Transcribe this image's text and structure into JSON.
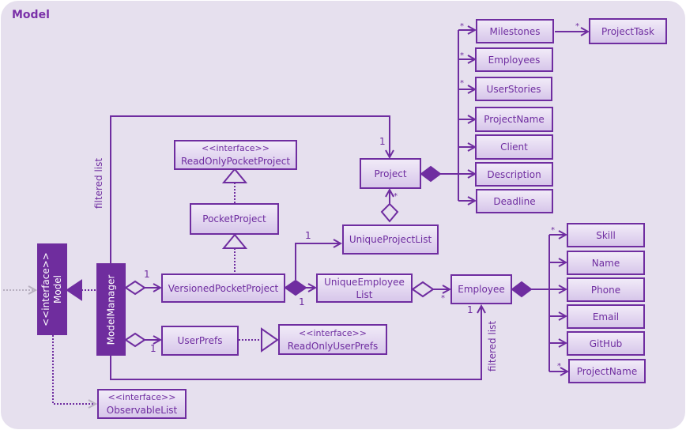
{
  "diagram": {
    "title": "Model",
    "colors": {
      "primary": "#6f2da0",
      "background": "#e6e0ee",
      "box_fill_top": "#f1ebf8",
      "box_fill_bottom": "#d7c6ea"
    },
    "interface_model": {
      "stereotype": "<<interface>>",
      "name": "Model"
    },
    "model_manager": {
      "name": "ModelManager"
    },
    "read_only_pocket_project": {
      "stereotype": "<<interface>>",
      "name": "ReadOnlyPocketProject"
    },
    "pocket_project": {
      "name": "PocketProject"
    },
    "versioned_pocket_project": {
      "name": "VersionedPocketProject"
    },
    "unique_project_list": {
      "name": "UniqueProjectList"
    },
    "unique_employee_list": {
      "name_line1": "UniqueEmployee",
      "name_line2": "List"
    },
    "project": {
      "name": "Project"
    },
    "employee": {
      "name": "Employee"
    },
    "user_prefs": {
      "name": "UserPrefs"
    },
    "read_only_user_prefs": {
      "stereotype": "<<interface>>",
      "name": "ReadOnlyUserPrefs"
    },
    "observable_list": {
      "stereotype": "<<interface>>",
      "name": "ObservableList"
    },
    "project_attributes": [
      "Milestones",
      "Employees",
      "UserStories",
      "ProjectName",
      "Client",
      "Description",
      "Deadline"
    ],
    "project_task": {
      "name": "ProjectTask"
    },
    "employee_attributes": [
      "Skill",
      "Name",
      "Phone",
      "Email",
      "GitHub",
      "ProjectName"
    ],
    "labels": {
      "filtered_list": "filtered list",
      "one": "1",
      "many": "*"
    }
  }
}
